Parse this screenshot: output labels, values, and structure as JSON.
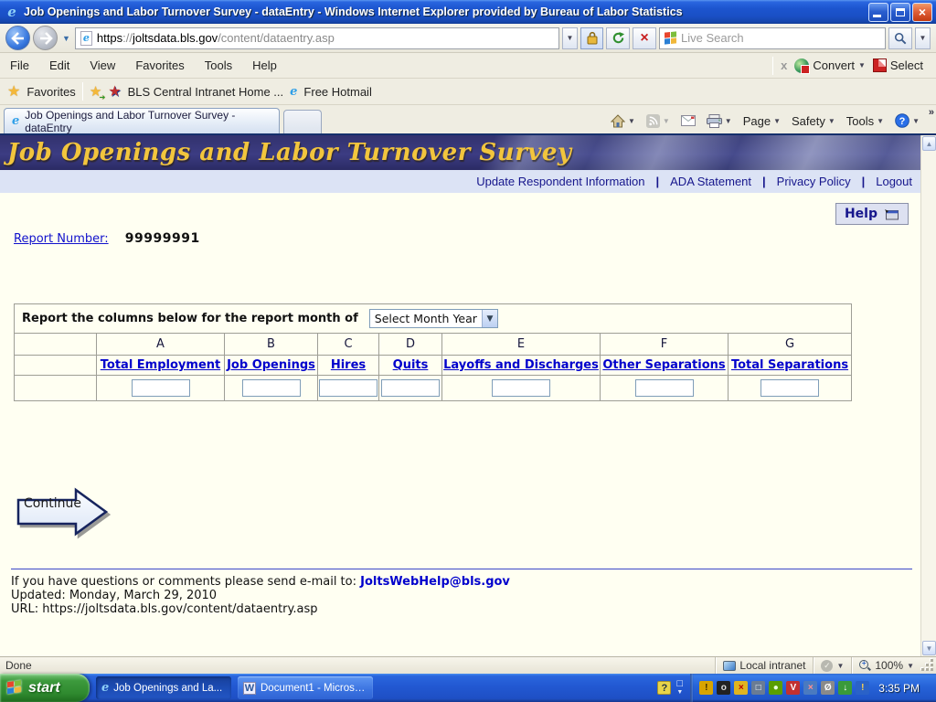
{
  "window": {
    "title": "Job Openings and Labor Turnover Survey - dataEntry - Windows Internet Explorer provided by Bureau of Labor Statistics"
  },
  "browser": {
    "url": {
      "scheme": "https",
      "sep": "://",
      "domain": "joltsdata.bls.gov",
      "path": "/content/dataentry.asp"
    },
    "search_placeholder": "Live Search",
    "menu": [
      "File",
      "Edit",
      "View",
      "Favorites",
      "Tools",
      "Help"
    ],
    "commandbar": {
      "close": "x",
      "convert": "Convert",
      "select": "Select"
    },
    "favorites": {
      "label": "Favorites",
      "bls": "BLS Central Intranet Home ...",
      "hotmail": "Free Hotmail"
    },
    "tab_title": "Job Openings and Labor Turnover Survey - dataEntry",
    "toolbar": {
      "page": "Page",
      "safety": "Safety",
      "tools": "Tools",
      "overflow": "»"
    }
  },
  "page": {
    "banner_title": "Job Openings and Labor Turnover Survey",
    "nav": {
      "links": [
        "Update Respondent Information",
        "ADA Statement",
        "Privacy Policy",
        "Logout"
      ],
      "sep": "|"
    },
    "help_label": "Help",
    "report": {
      "label": "Report Number:",
      "value": "99999991"
    },
    "table": {
      "caption": "Report the columns below for the report month of",
      "month_select": "Select Month Year",
      "columns": [
        {
          "letter": "A",
          "label": "Total Employment"
        },
        {
          "letter": "B",
          "label": "Job Openings"
        },
        {
          "letter": "C",
          "label": "Hires"
        },
        {
          "letter": "D",
          "label": "Quits"
        },
        {
          "letter": "E",
          "label": "Layoffs and Discharges"
        },
        {
          "letter": "F",
          "label": "Other Separations"
        },
        {
          "letter": "G",
          "label": "Total Separations"
        }
      ]
    },
    "continue_label": "Continue",
    "footer": {
      "contact_prefix": "If you have questions or comments please send e-mail to: ",
      "email": "JoltsWebHelp@bls.gov",
      "updated": "Updated: Monday, March 29, 2010",
      "url_line": "URL: https://joltsdata.bls.gov/content/dataentry.asp"
    }
  },
  "statusbar": {
    "status": "Done",
    "zone": "Local intranet",
    "zoom": "100%"
  },
  "taskbar": {
    "start_label": "start",
    "tasks": [
      {
        "label": "Job Openings and La..."
      },
      {
        "label": "Document1 - Microsof..."
      }
    ],
    "clock": "3:35 PM",
    "tray_icons": [
      {
        "name": "wireless-warning-icon",
        "glyph": "!"
      },
      {
        "name": "key-icon",
        "glyph": "o"
      },
      {
        "name": "key-disabled-icon",
        "glyph": "×"
      },
      {
        "name": "display-settings-icon",
        "glyph": "□"
      },
      {
        "name": "nvidia-icon",
        "glyph": "●"
      },
      {
        "name": "antivirus-shield-icon",
        "glyph": "V"
      },
      {
        "name": "network-error-icon",
        "glyph": "×"
      },
      {
        "name": "sync-blocked-icon",
        "glyph": "Ø"
      },
      {
        "name": "update-download-icon",
        "glyph": "↓"
      },
      {
        "name": "security-alert-icon",
        "glyph": "!"
      }
    ]
  },
  "colors": {
    "link_blue": "#0000cc",
    "banner_gold": "#f2c53d",
    "taskbar_blue": "#2258d2",
    "start_green": "#2f8a2f",
    "page_bg": "#fffff2"
  }
}
